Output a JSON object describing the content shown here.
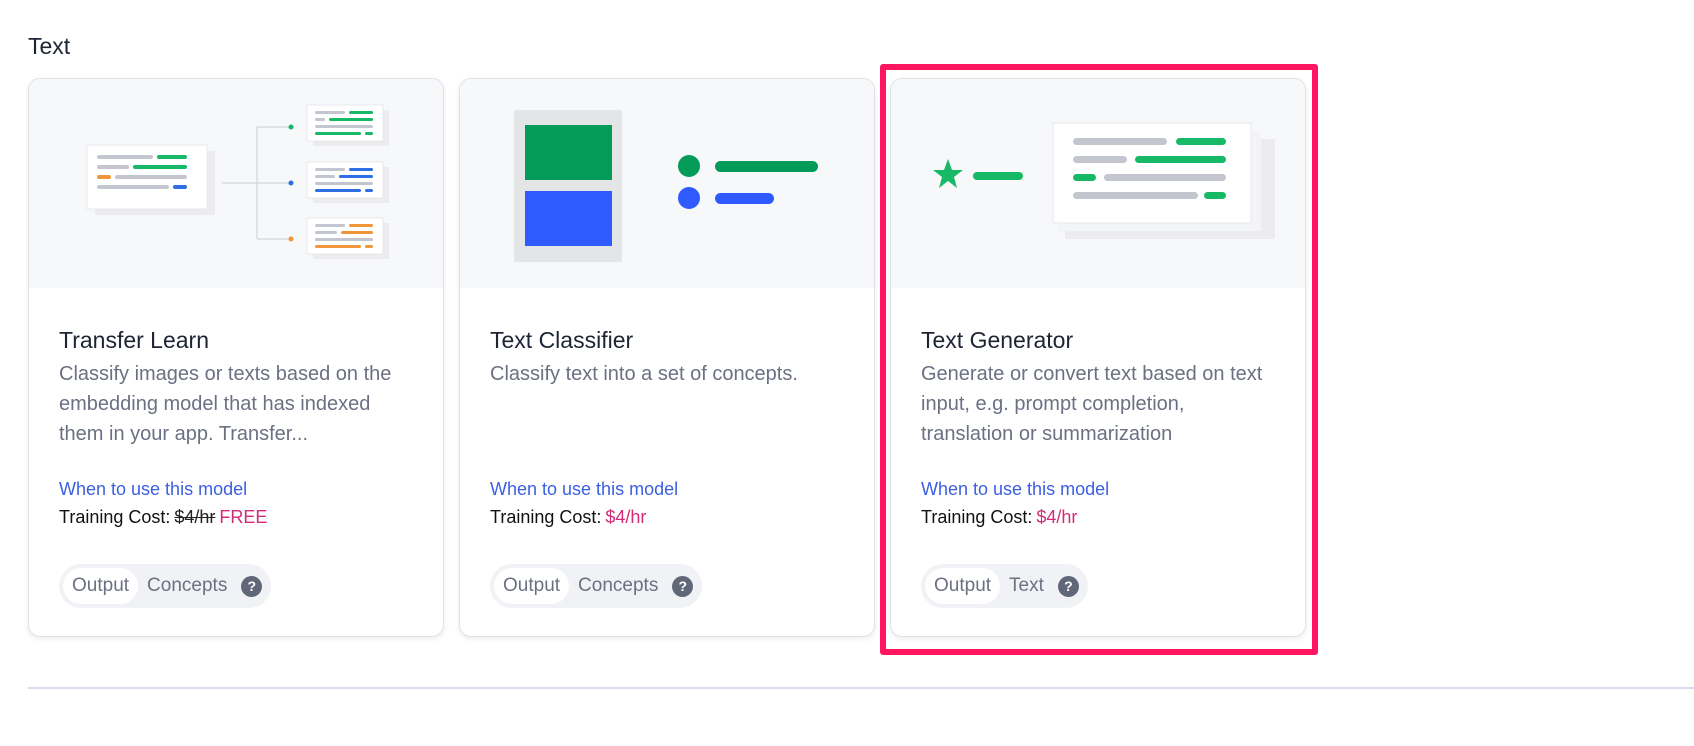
{
  "section": {
    "title": "Text"
  },
  "cards": [
    {
      "title": "Transfer Learn",
      "description": "Classify images or texts based on the embedding model that has indexed them in your app. Transfer...",
      "link": "When to use this model",
      "cost_label": "Training Cost:",
      "cost_old": "$4/hr",
      "cost_value": "FREE",
      "output_label": "Output",
      "output_value": "Concepts",
      "help": "?"
    },
    {
      "title": "Text Classifier",
      "description": "Classify text into a set of concepts.",
      "link": "When to use this model",
      "cost_label": "Training Cost:",
      "cost_value": "$4/hr",
      "output_label": "Output",
      "output_value": "Concepts",
      "help": "?"
    },
    {
      "title": "Text Generator",
      "description": "Generate or convert text based on text input, e.g. prompt completion, translation or summarization",
      "link": "When to use this model",
      "cost_label": "Training Cost:",
      "cost_value": "$4/hr",
      "output_label": "Output",
      "output_value": "Text",
      "help": "?"
    }
  ],
  "colors": {
    "accent_green": "#17b866",
    "accent_blue": "#2f6fe4",
    "accent_orange": "#f0963a",
    "link": "#3b5fe0",
    "price": "#d42b78",
    "highlight": "#ff1560"
  }
}
